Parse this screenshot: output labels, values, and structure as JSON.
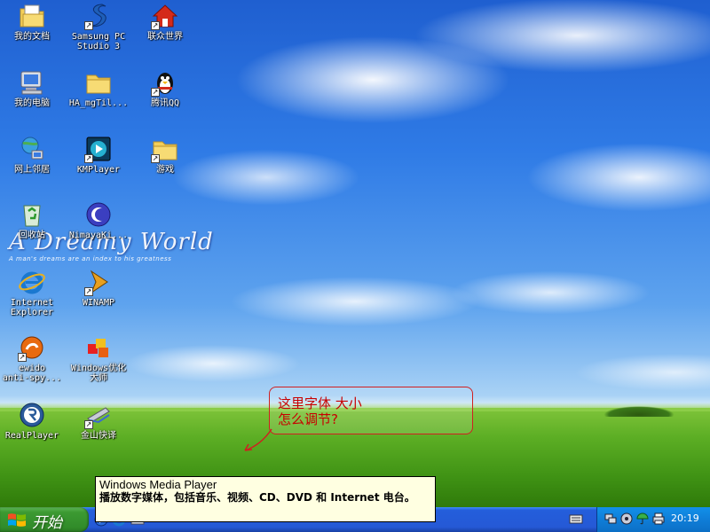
{
  "wallpaper": {
    "title": "A Dreamy World",
    "subtitle": "A man's dreams are an index to his greatness"
  },
  "desktop_icons": [
    {
      "label": "我的文档",
      "icon": "my-documents-icon",
      "shortcut": false
    },
    {
      "label": "Samsung PC\nStudio 3",
      "icon": "samsung-pc-studio-icon",
      "shortcut": true
    },
    {
      "label": "联众世界",
      "icon": "home-icon",
      "shortcut": true
    },
    {
      "label": "我的电脑",
      "icon": "my-computer-icon",
      "shortcut": false
    },
    {
      "label": "HA_mgTil...",
      "icon": "folder-icon",
      "shortcut": false
    },
    {
      "label": "腾讯QQ",
      "icon": "qq-penguin-icon",
      "shortcut": true
    },
    {
      "label": "网上邻居",
      "icon": "network-places-icon",
      "shortcut": false
    },
    {
      "label": "KMPlayer",
      "icon": "kmplayer-icon",
      "shortcut": true
    },
    {
      "label": "游戏",
      "icon": "folder-icon",
      "shortcut": true
    },
    {
      "label": "回收站",
      "icon": "recycle-bin-icon",
      "shortcut": false
    },
    {
      "label": "NimayaKi...",
      "icon": "nimaya-icon",
      "shortcut": false
    },
    {
      "label": "Internet\nExplorer",
      "icon": "internet-explorer-icon",
      "shortcut": false
    },
    {
      "label": "WINAMP",
      "icon": "winamp-icon",
      "shortcut": true
    },
    {
      "label": "ewido\nanti-spy...",
      "icon": "ewido-icon",
      "shortcut": true
    },
    {
      "label": "Windows优化\n大师",
      "icon": "windows-optimizer-icon",
      "shortcut": false
    },
    {
      "label": "RealPlayer",
      "icon": "realplayer-icon",
      "shortcut": false
    },
    {
      "label": "金山快译",
      "icon": "kingsoft-translator-icon",
      "shortcut": true
    }
  ],
  "annotation": {
    "text": "这里字体 大小\n怎么调节?",
    "color": "#c80000"
  },
  "tooltip": {
    "title": "Windows Media Player",
    "body": "播放数字媒体，包括音乐、视频、CD、DVD 和 Internet 电台。"
  },
  "taskbar": {
    "start_label": "开始",
    "clock": "20:19",
    "quick_launch": [
      "windows-media-player-icon",
      "ie-icon",
      "desktop-icon"
    ],
    "tray_icons": [
      "network-icon",
      "volume-icon",
      "umbrella-icon",
      "printer-icon"
    ]
  },
  "colors": {
    "taskbar_blue": "#245edb",
    "start_green": "#3c9a32",
    "tooltip_bg": "#ffffe1",
    "annotation_red": "#d02020"
  }
}
